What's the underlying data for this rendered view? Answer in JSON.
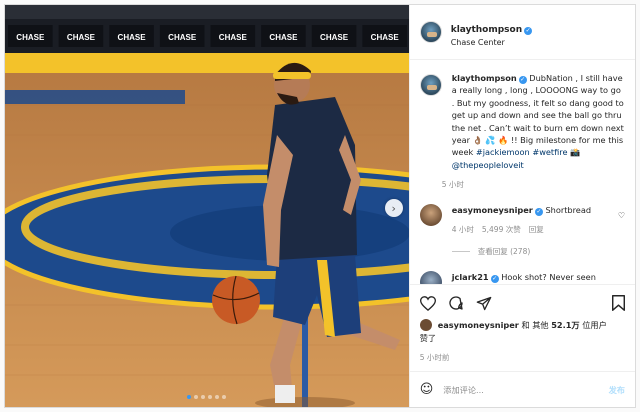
{
  "header": {
    "username": "klaythompson",
    "location": "Chase Center",
    "more_icon": "more-horizontal-icon"
  },
  "photo": {
    "arena_signs": [
      "CHASE",
      "CHASE",
      "CHASE",
      "CHASE",
      "CHASE",
      "CHASE",
      "CHASE",
      "CHASE"
    ],
    "colors": {
      "court_blue": "#1d4a8c",
      "court_yellow": "#f3c22a",
      "floor": "#c98a4c"
    },
    "dot_count": 6,
    "active_dot": 1
  },
  "caption": {
    "username": "klaythompson",
    "text": "DubNation , I still have a really long , long , LOOOONG way to go . But my goodness, it felt so dang good to get up and down and see the ball go thru the net . Can’t wait to burn em down next year 👌🏽 💦 🔥 !! Big milestone for me this week",
    "tags": "#jackiemoon #wetfire 📸",
    "mention": "@thepeopleloveit",
    "time": "5 小时"
  },
  "comments": [
    {
      "username": "easymoneysniper",
      "text": "Shortbread",
      "time": "4 小时",
      "likes": "5,499 次赞",
      "reply": "回复",
      "view_replies": "查看回复 (278)"
    },
    {
      "username": "jclark21",
      "text": "Hook shot? Never seen"
    }
  ],
  "actions": {
    "liked_by_prefix": "easymoneysniper",
    "liked_by_text": "和 其他",
    "liked_by_count": "52.1万",
    "liked_by_suffix": "位用户",
    "liked_by_line2": "赞了",
    "time": "5 小时前"
  },
  "add_comment": {
    "placeholder": "添加评论...",
    "post_label": "发布"
  },
  "colors": {
    "verified_blue": "#3897f0",
    "link_blue": "#00376b",
    "muted": "#8e8e8e"
  }
}
